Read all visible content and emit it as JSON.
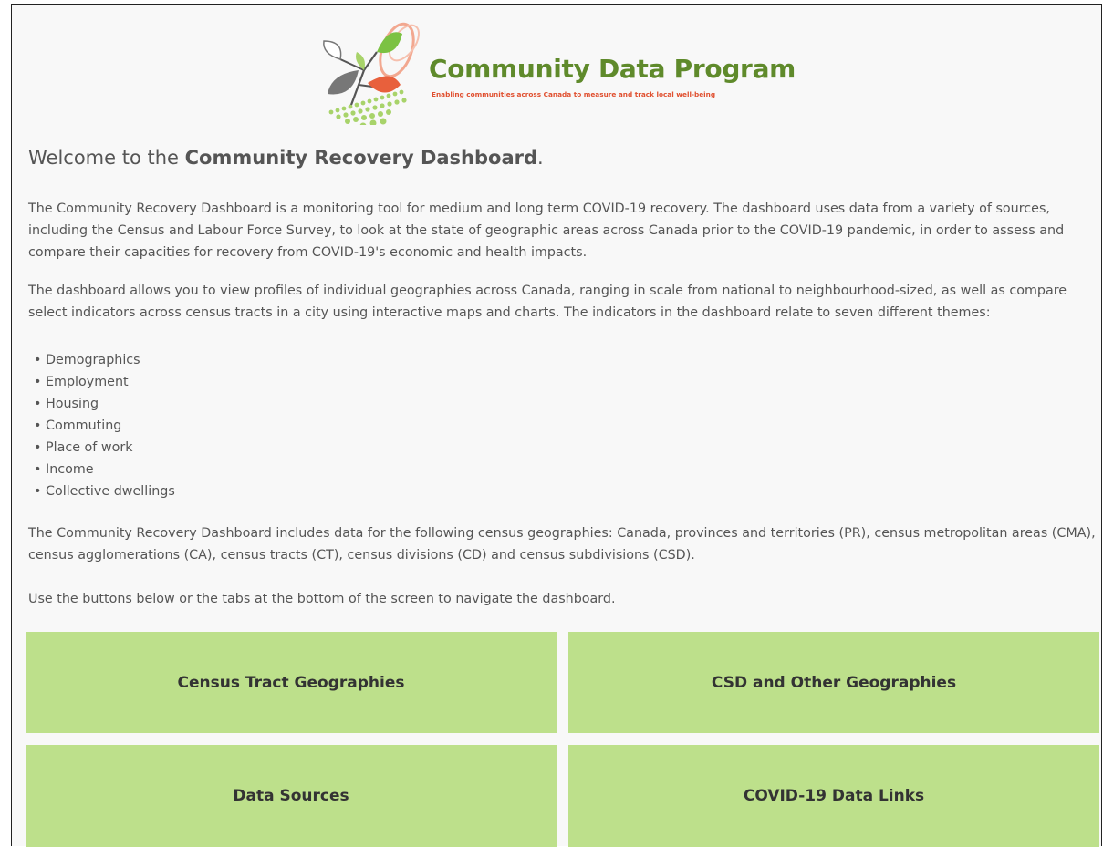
{
  "logo": {
    "title": "Community Data Program",
    "tagline": "Enabling communities across Canada to measure and track local well-being"
  },
  "welcome": {
    "prefix": "Welcome to the ",
    "strong": "Community Recovery Dashboard",
    "suffix": "."
  },
  "paragraphs": {
    "intro": "The Community Recovery Dashboard is a monitoring tool for medium and long term COVID-19 recovery. The dashboard uses data from a variety of sources, including the Census and Labour Force Survey, to look at the state of geographic areas across Canada prior to the COVID-19 pandemic, in order to assess and compare their capacities for recovery from COVID-19's economic and health impacts.",
    "profiles": "The dashboard allows you to view profiles of individual geographies across Canada, ranging in scale from national to neighbourhood-sized, as well as compare select indicators across census tracts in a city using interactive maps and charts. The indicators in the dashboard relate to seven different themes:",
    "geographies": "The Community Recovery Dashboard includes data for the following census geographies: Canada, provinces and territories (PR), census metropolitan areas (CMA), census agglomerations (CA), census tracts (CT), census divisions (CD) and census subdivisions (CSD).",
    "navigate": "Use the buttons below or the tabs at the bottom of the screen to navigate the dashboard."
  },
  "themes": [
    "Demographics",
    "Employment",
    "Housing",
    "Commuting",
    "Place of work",
    "Income",
    "Collective dwellings"
  ],
  "buttons": {
    "census_tract": "Census Tract Geographies",
    "csd_other": "CSD and Other Geographies",
    "data_sources": "Data Sources",
    "covid_links": "COVID-19 Data Links"
  },
  "colors": {
    "button_bg": "#bde08b",
    "logo_green": "#5f8a2b",
    "logo_orange": "#e05030"
  }
}
